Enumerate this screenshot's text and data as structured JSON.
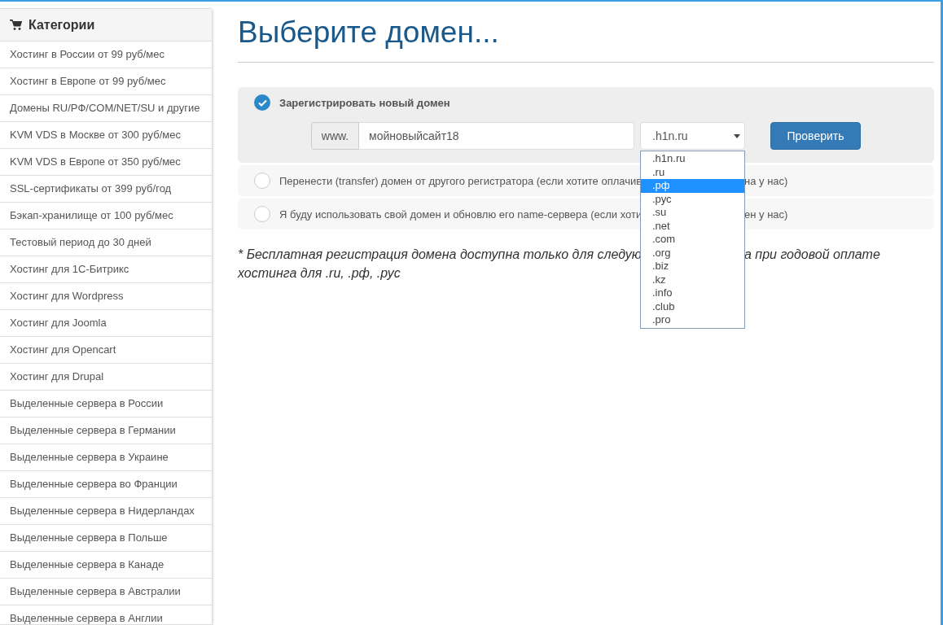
{
  "sidebar": {
    "title": "Категории",
    "items": [
      {
        "label": "Хостинг в России от 99 руб/мес"
      },
      {
        "label": "Хостинг в Европе от 99 руб/мес"
      },
      {
        "label": "Домены RU/РФ/COM/NET/SU и другие"
      },
      {
        "label": "KVM VDS в Москве от 300 руб/мес"
      },
      {
        "label": "KVM VDS в Европе от 350 руб/мес"
      },
      {
        "label": "SSL-сертификаты от 399 руб/год"
      },
      {
        "label": "Бэкап-хранилище от 100 руб/мес"
      },
      {
        "label": "Тестовый период до 30 дней"
      },
      {
        "label": "Хостинг для 1С-Битрикс"
      },
      {
        "label": "Хостинг для Wordpress"
      },
      {
        "label": "Хостинг для Joomla"
      },
      {
        "label": "Хостинг для Opencart"
      },
      {
        "label": "Хостинг для Drupal"
      },
      {
        "label": "Выделенные сервера в России"
      },
      {
        "label": "Выделенные сервера в Германии"
      },
      {
        "label": "Выделенные сервера в Украине"
      },
      {
        "label": "Выделенные сервера во Франции"
      },
      {
        "label": "Выделенные сервера в Нидерландах"
      },
      {
        "label": "Выделенные сервера в Польше"
      },
      {
        "label": "Выделенные сервера в Канаде"
      },
      {
        "label": "Выделенные сервера в Австралии"
      },
      {
        "label": "Выделенные сервера в Англии"
      }
    ]
  },
  "heading": "Выберите домен...",
  "options": [
    {
      "selected": true,
      "label": "Зарегистрировать новый домен",
      "prefix": "www.",
      "value": "мойновыйсайт18",
      "zone": ".h1n.ru",
      "zones": [
        {
          "label": ".h1n.ru",
          "selected": false
        },
        {
          "label": ".ru",
          "selected": false
        },
        {
          "label": ".рф",
          "selected": true
        },
        {
          "label": ".рус",
          "selected": false
        },
        {
          "label": ".su",
          "selected": false
        },
        {
          "label": ".net",
          "selected": false
        },
        {
          "label": ".com",
          "selected": false
        },
        {
          "label": ".org",
          "selected": false
        },
        {
          "label": ".biz",
          "selected": false
        },
        {
          "label": ".kz",
          "selected": false
        },
        {
          "label": ".info",
          "selected": false
        },
        {
          "label": ".club",
          "selected": false
        },
        {
          "label": ".pro",
          "selected": false
        }
      ],
      "button": "Проверить"
    },
    {
      "selected": false,
      "label_start": "Перенести (transfer) домен от другого регистратора (если хотите оплачив",
      "label_end": "на у нас)"
    },
    {
      "selected": false,
      "label_start": "Я буду использовать свой домен и обновлю его name-сервера (если хоти",
      "label_end": "ен у нас)"
    }
  ],
  "note": {
    "line1_start": "* Бесплатная регистрация домена доступна только для следую",
    "line1_end": "а при годовой оплате",
    "line2": "хостинга для .ru, .рф, .рус"
  }
}
